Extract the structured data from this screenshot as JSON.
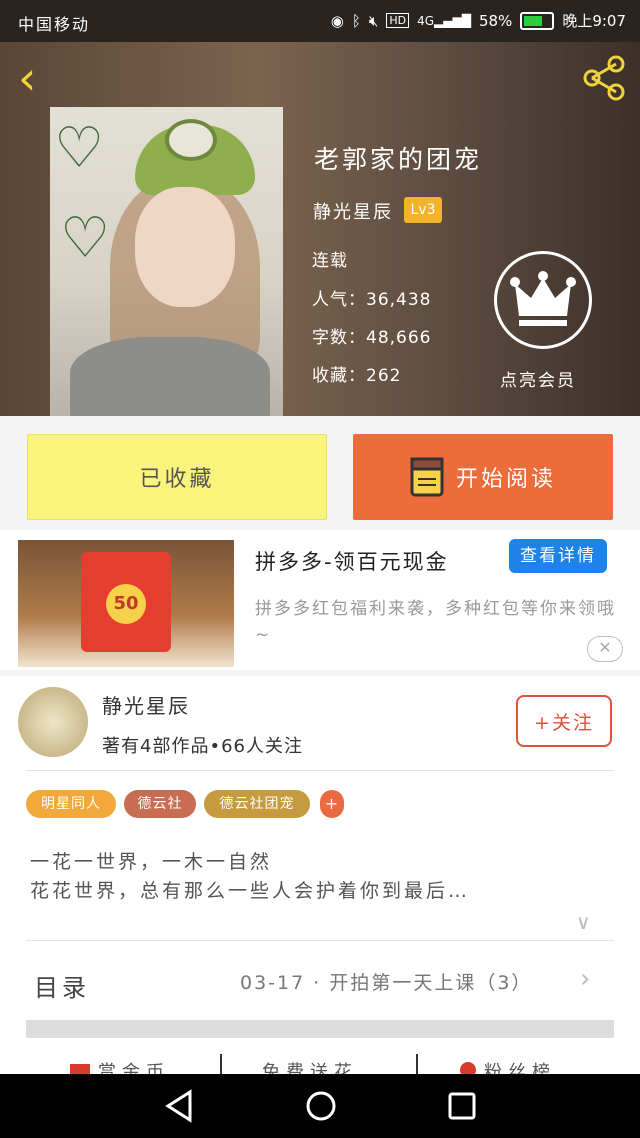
{
  "status_bar": {
    "carrier": "中国移动",
    "battery": "58%",
    "time": "晚上9:07"
  },
  "book": {
    "title": "老郭家的团宠",
    "author": "静光星辰",
    "level": "Lv3",
    "status": "连载",
    "popularity": "人气：36,438",
    "word_count": "字数：48,666",
    "favorites": "收藏：262"
  },
  "vip": {
    "label": "点亮会员"
  },
  "actions": {
    "favorited_label": "已收藏",
    "read_label": "开始阅读"
  },
  "ad": {
    "title": "拼多多-领百元现金",
    "button": "查看详情",
    "description": "拼多多红包福利来袭，多种红包等你来领哦~",
    "image_badge": "50"
  },
  "author_card": {
    "name": "静光星辰",
    "info": "著有4部作品•66人关注",
    "follow_label": "+关注"
  },
  "tags": [
    {
      "label": "明星同人",
      "color": "#f2a83a"
    },
    {
      "label": "德云社",
      "color": "#c86d54"
    },
    {
      "label": "德云社团宠",
      "color": "#c69a3e"
    },
    {
      "label": "+",
      "color": "#ea6a42"
    }
  ],
  "synopsis": {
    "line1": "一花一世界，一木一自然",
    "line2": "花花世界，总有那么一些人会护着你到最后…"
  },
  "toc": {
    "label": "目录",
    "latest": "03-17 · 开拍第一天上课（3）"
  },
  "bottom_tabs": [
    "赏金币",
    "免费送花",
    "粉丝榜"
  ]
}
